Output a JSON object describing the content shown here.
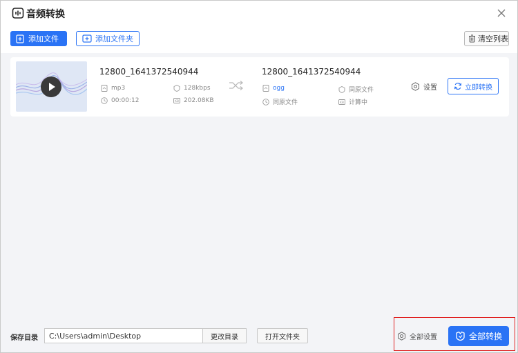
{
  "window": {
    "title": "音频转换",
    "close_icon": "close-icon"
  },
  "toolbar": {
    "add_file_label": "添加文件",
    "add_folder_label": "添加文件夹",
    "clear_list_label": "清空列表"
  },
  "file": {
    "source": {
      "name": "12800_1641372540944",
      "format": "mp3",
      "bitrate": "128kbps",
      "duration": "00:00:12",
      "size": "202.08KB"
    },
    "target": {
      "name": "12800_1641372540944",
      "format": "ogg",
      "bitrate": "同原文件",
      "duration": "同原文件",
      "size": "计算中"
    },
    "settings_label": "设置",
    "convert_now_label": "立即转换"
  },
  "bottom": {
    "save_dir_label": "保存目录",
    "save_dir_value": "C:\\Users\\admin\\Desktop",
    "change_dir_label": "更改目录",
    "open_folder_label": "打开文件夹",
    "all_settings_label": "全部设置",
    "convert_all_label": "全部转换"
  },
  "colors": {
    "accent": "#2a73f5",
    "highlight": "#e02020"
  }
}
